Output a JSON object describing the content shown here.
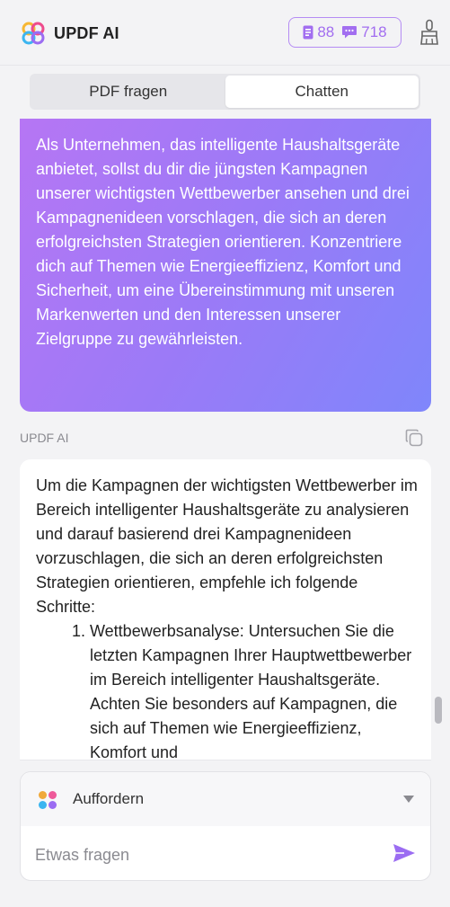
{
  "header": {
    "app_title": "UPDF AI",
    "credits": {
      "documents_count": "88",
      "chat_count": "718",
      "color": "#a26ef0"
    },
    "icons": [
      "updf-logo-icon",
      "document-icon",
      "chat-bubble-icon",
      "brush-icon"
    ]
  },
  "tabs": [
    {
      "label": "PDF fragen",
      "active": false
    },
    {
      "label": "Chatten",
      "active": true
    }
  ],
  "conversation": {
    "user_message": "Als Unternehmen, das intelligente Haushaltsgeräte anbietet, sollst du dir die jüngsten Kampagnen unserer wichtigsten Wettbewerber ansehen und drei Kampagnenideen vorschlagen, die sich an deren erfolgreichsten Strategien orientieren. Konzentriere dich auf Themen wie Energieeffizienz, Komfort und Sicherheit, um eine Übereinstimmung mit unseren Markenwerten und den Interessen unserer Zielgruppe zu gewährleisten.",
    "ai_label": "UPDF AI",
    "ai_intro": "Um die Kampagnen der wichtigsten Wettbewerber im Bereich intelligenter Haushaltsgeräte zu analysieren und darauf basierend drei Kampagnenideen vorzuschlagen, die sich an deren erfolgreichsten Strategien orientieren, empfehle ich folgende Schritte:",
    "ai_steps": [
      "Wettbewerbsanalyse: Untersuchen Sie die letzten Kampagnen Ihrer Hauptwettbewerber im Bereich intelligenter Haushaltsgeräte. Achten Sie besonders auf Kampagnen, die sich auf Themen wie Energieeffizienz, Komfort und"
    ]
  },
  "composer": {
    "mode_label": "Auffordern",
    "placeholder": "Etwas fragen",
    "value": "",
    "accent_color": "#9b6cf2"
  }
}
